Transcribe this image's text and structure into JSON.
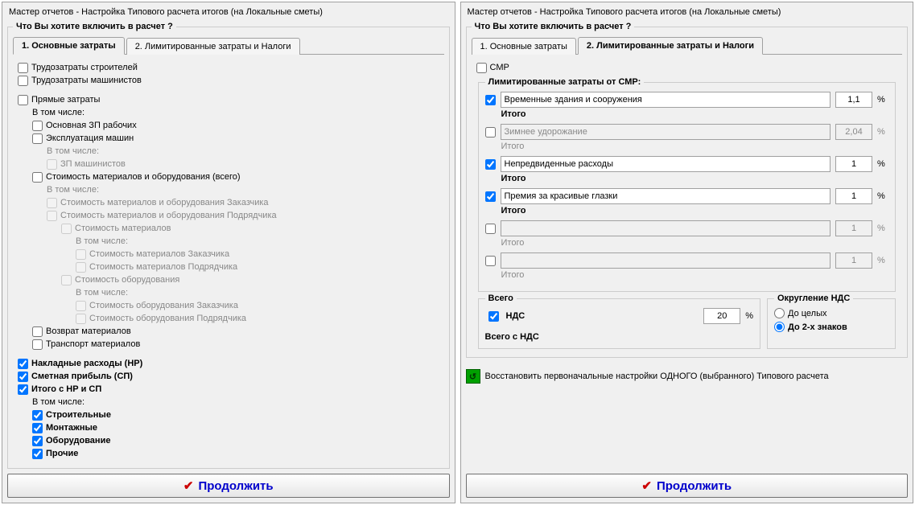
{
  "title": "Мастер отчетов - Настройка Типового расчета итогов (на Локальные сметы)",
  "group_question": "Что Вы хотите включить в расчет ?",
  "tabs": {
    "tab1": "1. Основные затраты",
    "tab2": "2. Лимитированные затраты  и  Налоги"
  },
  "left": {
    "c1": "Трудозатраты строителей",
    "c2": "Трудозатраты машинистов",
    "c3": "Прямые затраты",
    "c3a": "В том числе:",
    "c4": "Основная ЗП рабочих",
    "c5": "Эксплуатация машин",
    "c5a": "В том числе:",
    "c6": "ЗП машинистов",
    "c7": "Стоимость материалов и оборудования (всего)",
    "c7a": "В том числе:",
    "c8": "Стоимость материалов и оборудования Заказчика",
    "c9": "Стоимость материалов и оборудования Подрядчика",
    "c10": "Стоимость материалов",
    "c10a": "В том числе:",
    "c11": "Стоимость материалов Заказчика",
    "c12": "Стоимость материалов Подрядчика",
    "c13": "Стоимость оборудования",
    "c13a": "В том числе:",
    "c14": "Стоимость оборудования Заказчика",
    "c15": "Стоимость оборудования Подрядчика",
    "c16": "Возврат материалов",
    "c17": "Транспорт материалов",
    "c18": "Накладные расходы (НР)",
    "c19": "Сметная прибыль (СП)",
    "c20": "Итого с НР и СП",
    "c20a": "В том числе:",
    "c21": "Строительные",
    "c22": "Монтажные",
    "c23": "Оборудование",
    "c24": "Прочие"
  },
  "right": {
    "smr": "СМР",
    "lim_title": "Лимитированные затраты от СМР:",
    "r1": {
      "enabled": true,
      "desc": "Временные здания и сооружения",
      "val": "1,1"
    },
    "r2": {
      "enabled": false,
      "desc": "Зимнее удорожание",
      "val": "2,04"
    },
    "r3": {
      "enabled": true,
      "desc": "Непредвиденные расходы",
      "val": "1"
    },
    "r4": {
      "enabled": true,
      "desc": "Премия за красивые глазки",
      "val": "1"
    },
    "r5": {
      "enabled": false,
      "desc": "",
      "val": "1"
    },
    "r6": {
      "enabled": false,
      "desc": "",
      "val": "1"
    },
    "itogo": "Итого",
    "pct": "%",
    "vsego_title": "Всего",
    "nds": "НДС",
    "nds_val": "20",
    "vsego_nds": "Всего с НДС",
    "round_title": "Округление НДС",
    "round1": "До целых",
    "round2": "До 2-х знаков",
    "restore": "Восстановить первоначальные настройки ОДНОГО (выбранного) Типового расчета"
  },
  "continue": "Продолжить"
}
